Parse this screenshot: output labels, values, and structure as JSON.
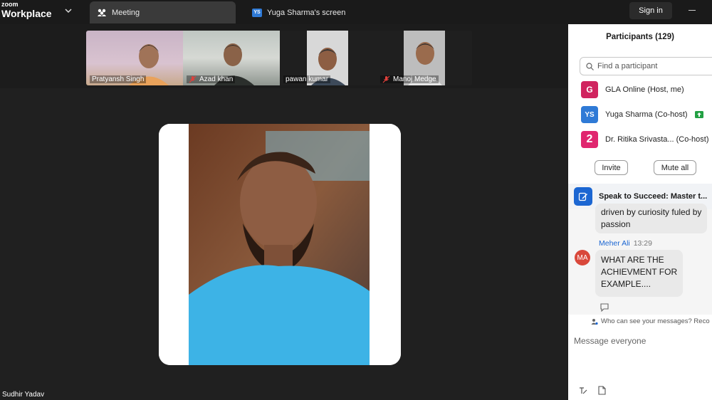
{
  "app": {
    "brand_small": "zoom",
    "brand_large": "Workplace",
    "sign_in_label": "Sign in"
  },
  "tabs": [
    {
      "label": "Meeting",
      "icon": "people-icon",
      "active": true
    },
    {
      "label": "Yuga Sharma's screen",
      "icon": "ys-badge",
      "badge": "YS"
    }
  ],
  "thumbnails": [
    {
      "name": "Pratyansh Singh",
      "muted": false
    },
    {
      "name": "Azad khan",
      "muted": true
    },
    {
      "name": "pawan kumar",
      "muted": false
    },
    {
      "name": "Manoj Medge",
      "muted": true
    }
  ],
  "stage": {
    "active_speaker": "Sudhir Yadav"
  },
  "participants": {
    "title": "Participants (129)",
    "search_placeholder": "Find a participant",
    "list": [
      {
        "initial": "G",
        "name": "GLA Online (Host, me)",
        "color": "#d0245f"
      },
      {
        "initial": "YS",
        "name": "Yuga Sharma (Co-host)",
        "color": "#2f7ad6",
        "sharing": true
      },
      {
        "initial": "2",
        "name": "Dr. Ritika Srivasta... (Co-host)",
        "color": "#e0266f"
      }
    ],
    "invite_label": "Invite",
    "mute_all_label": "Mute all"
  },
  "chat": {
    "header_title": "Speak to Succeed: Master t...",
    "prev_message_line1": "driven by curiosity fuled by",
    "prev_message_line2": "passion",
    "sender": "Meher Ali",
    "sender_initials": "MA",
    "time": "13:29",
    "message_lines": [
      "WHAT ARE THE",
      "ACHIEVMENT FOR",
      "EXAMPLE...."
    ],
    "visibility_notice": "Who can see your messages? Reco",
    "compose_placeholder": "Message everyone"
  },
  "colors": {
    "accent": "#1b66d2",
    "dark_bg": "#1c1c1c",
    "panel_bg": "#ffffff"
  }
}
